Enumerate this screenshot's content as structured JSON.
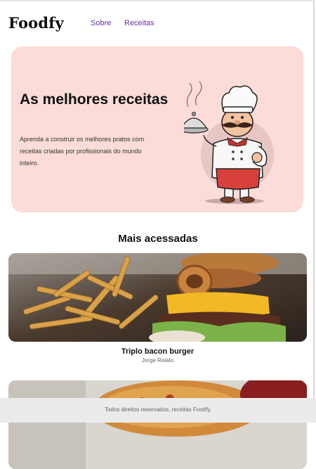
{
  "header": {
    "logo": "Foodfy",
    "nav": [
      {
        "label": "Sobre"
      },
      {
        "label": "Receitas"
      }
    ]
  },
  "hero": {
    "title": "As melhores receitas",
    "description": "Aprenda a construir os melhores pratos com receitas criadas por profissionais do mundo inteiro.",
    "image_icon": "chef-illustration-icon"
  },
  "section": {
    "title": "Mais acessadas"
  },
  "recipes": [
    {
      "title": "Triplo bacon burger",
      "author": "Jorge Relato",
      "image_icon": "burger-photo-icon"
    },
    {
      "title": "",
      "author": "",
      "image_icon": "pizza-photo-icon"
    }
  ],
  "footer": {
    "text": "Todos direitos reservados, receitas Foodfy."
  },
  "colors": {
    "accent": "#6b2fa0",
    "hero_bg": "#fbdcd8",
    "footer_bg": "#ebebeb"
  }
}
